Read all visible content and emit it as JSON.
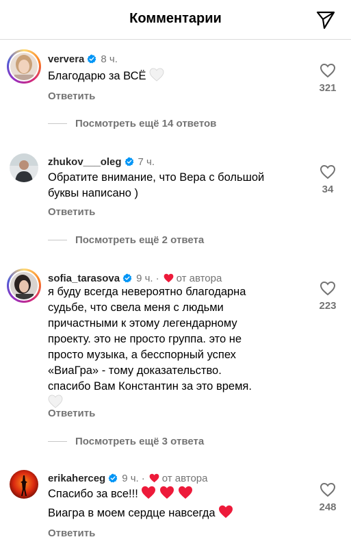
{
  "header": {
    "title": "Комментарии",
    "share_icon": "send-paper-plane-icon"
  },
  "colors": {
    "muted": "#737373",
    "heart_red": "#ed1a3a",
    "verified_blue": "#0095f6"
  },
  "comments": [
    {
      "username": "ververa",
      "time": "8 ч.",
      "lines": [
        "Благодарю за ВСЁ"
      ],
      "reply": "Ответить",
      "likes": "321",
      "more": "Посмотреть ещё 14 ответов"
    },
    {
      "username": "zhukov___oleg",
      "time": "7 ч.",
      "lines": [
        "Обратите внимание, что Вера с большой",
        "буквы написано )"
      ],
      "reply": "Ответить",
      "likes": "34",
      "more": "Посмотреть ещё 2 ответа"
    },
    {
      "username": "sofia_tarasova",
      "time": "9 ч.",
      "dot": "·",
      "author_label": "от автора",
      "lines": [
        "я буду всегда невероятно благодарна",
        "судьбе, что свела меня с людьми",
        "причастными к этому легендарному",
        "проекту. это не просто группа. это не",
        "просто музыка, а бесспорный успех",
        "«ВиаГра» - тому доказательство.",
        "спасибо Вам Константин за это время."
      ],
      "reply": "Ответить",
      "likes": "223",
      "more": "Посмотреть ещё 3 ответа"
    },
    {
      "username": "erikaherceg",
      "time": "9 ч.",
      "dot": "·",
      "author_label": "от автора",
      "lines": [
        "Спасибо за все!!!",
        "Виагра в моем сердце навсегда"
      ],
      "reply": "Ответить",
      "likes": "248"
    }
  ]
}
